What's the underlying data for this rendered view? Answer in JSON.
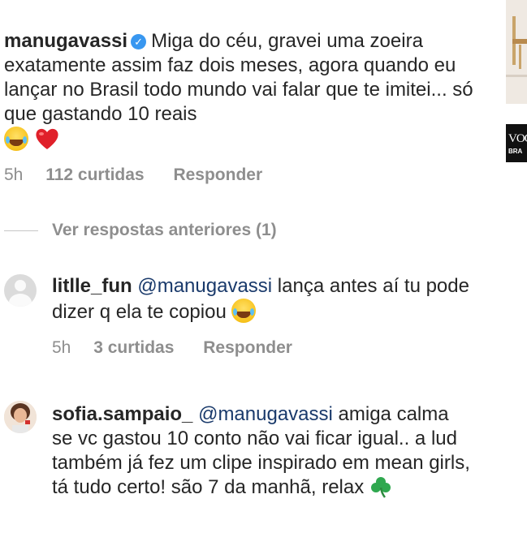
{
  "comments": [
    {
      "username": "manugavassi",
      "verified": true,
      "text": "Miga do céu, gravei uma zoeira exatamente assim faz dois meses, agora quando eu lançar no Brasil todo mundo vai falar que te imitei... só que gastando 10 reais",
      "emojis": [
        "face-with-tears-of-joy-icon",
        "red-heart-icon"
      ],
      "time": "5h",
      "likes": "112 curtidas",
      "reply_label": "Responder"
    },
    {
      "username": "litlle_fun",
      "mention": "@manugavassi",
      "text": "lança antes aí tu pode dizer q ela te copiou",
      "emojis": [
        "face-with-tears-of-joy-icon"
      ],
      "time": "5h",
      "likes": "3 curtidas",
      "reply_label": "Responder"
    },
    {
      "username": "sofia.sampaio_",
      "mention": "@manugavassi",
      "text": "amiga calma se vc gastou 10 conto não vai ficar igual.. a lud também já fez um clipe inspirado em mean girls, tá tudo certo! são 7 da manhã, relax",
      "emojis": [
        "shamrock-icon"
      ]
    }
  ],
  "view_replies_label": "Ver respostas anteriores (1)",
  "side_logo": {
    "main": "VOG",
    "sub": "BRA"
  },
  "colors": {
    "verified": "#3897f0",
    "meta": "#8e8e8e",
    "text": "#262626"
  }
}
